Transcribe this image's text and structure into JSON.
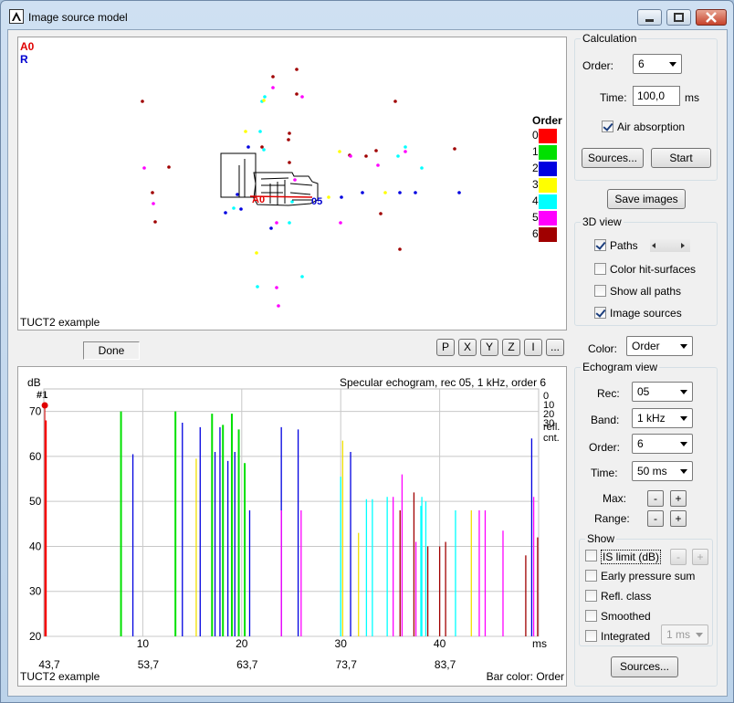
{
  "window": {
    "title": "Image source model"
  },
  "model_view": {
    "legend_a0": "A0",
    "legend_r": "R",
    "order_title": "Order",
    "order_legend": [
      {
        "label": "0",
        "color": "#ff0000"
      },
      {
        "label": "1",
        "color": "#00e000"
      },
      {
        "label": "2",
        "color": "#0000e0"
      },
      {
        "label": "3",
        "color": "#ffff00"
      },
      {
        "label": "4",
        "color": "#00ffff"
      },
      {
        "label": "5",
        "color": "#ff00ff"
      },
      {
        "label": "6",
        "color": "#a00000"
      }
    ],
    "source_label": "A0",
    "receiver_label": "05",
    "footer": "TUCT2 example"
  },
  "status": {
    "text": "Done"
  },
  "view_buttons": [
    "P",
    "X",
    "Y",
    "Z",
    "I",
    "..."
  ],
  "calculation": {
    "title": "Calculation",
    "order_label": "Order:",
    "order_value": "6",
    "time_label": "Time:",
    "time_value": "100,0",
    "time_unit": "ms",
    "air_absorption": "Air absorption",
    "sources_btn": "Sources...",
    "start_btn": "Start"
  },
  "save_images": "Save images",
  "view3d": {
    "title": "3D view",
    "paths": "Paths",
    "color_hit": "Color hit-surfaces",
    "show_all": "Show all paths",
    "image_sources": "Image sources"
  },
  "color": {
    "label": "Color:",
    "value": "Order"
  },
  "echogram_view": {
    "title": "Echogram view",
    "rec_label": "Rec:",
    "rec_value": "05",
    "band_label": "Band:",
    "band_value": "1 kHz",
    "order_label": "Order:",
    "order_value": "6",
    "time_label": "Time:",
    "time_value": "50 ms",
    "max_label": "Max:",
    "range_label": "Range:",
    "show_title": "Show",
    "is_limit": "IS limit (dB)",
    "early": "Early pressure sum",
    "refl_class": "Refl. class",
    "smoothed": "Smoothed",
    "integrated": "Integrated",
    "integrated_value": "1 ms",
    "sources_btn": "Sources..."
  },
  "chart_data": {
    "type": "bar",
    "title": "Specular echogram, rec 05, 1 kHz, order 6",
    "ylabel": "dB",
    "xlabel": "ms",
    "marker": "#1",
    "ylim": [
      20,
      75
    ],
    "y_ticks": [
      20,
      30,
      40,
      50,
      60,
      70
    ],
    "x_ticks": [
      "10",
      "20",
      "30",
      "40"
    ],
    "x_ticks_abs": [
      "43,7",
      "53,7",
      "63,7",
      "73,7",
      "83,7"
    ],
    "xlim": [
      0,
      50
    ],
    "refl_cnt_ticks": [
      "0",
      "10",
      "20",
      "30"
    ],
    "refl_cnt_label": "refl.\ncnt.",
    "footer_left": "TUCT2 example",
    "footer_right": "Bar color: Order",
    "bars": [
      {
        "x": 0.2,
        "y": 68,
        "order": 0
      },
      {
        "x": 7.8,
        "y": 70,
        "order": 1
      },
      {
        "x": 13.3,
        "y": 70,
        "order": 1
      },
      {
        "x": 17.0,
        "y": 69.5,
        "order": 1
      },
      {
        "x": 18.1,
        "y": 67,
        "order": 1
      },
      {
        "x": 19.0,
        "y": 69.5,
        "order": 1
      },
      {
        "x": 19.7,
        "y": 66,
        "order": 1
      },
      {
        "x": 20.3,
        "y": 58.5,
        "order": 1
      },
      {
        "x": 9.0,
        "y": 60.5,
        "order": 2
      },
      {
        "x": 14.0,
        "y": 67.5,
        "order": 2
      },
      {
        "x": 15.8,
        "y": 66.5,
        "order": 2
      },
      {
        "x": 17.3,
        "y": 61,
        "order": 2
      },
      {
        "x": 17.8,
        "y": 66.5,
        "order": 2
      },
      {
        "x": 18.6,
        "y": 59,
        "order": 2
      },
      {
        "x": 19.3,
        "y": 61,
        "order": 2
      },
      {
        "x": 20.8,
        "y": 48,
        "order": 2
      },
      {
        "x": 24.0,
        "y": 66.5,
        "order": 2
      },
      {
        "x": 25.7,
        "y": 66,
        "order": 2
      },
      {
        "x": 31.0,
        "y": 61,
        "order": 2
      },
      {
        "x": 49.3,
        "y": 64,
        "order": 2
      },
      {
        "x": 15.4,
        "y": 59.5,
        "order": 3
      },
      {
        "x": 30.2,
        "y": 63.5,
        "order": 3
      },
      {
        "x": 31.8,
        "y": 43,
        "order": 3
      },
      {
        "x": 43.2,
        "y": 48,
        "order": 3
      },
      {
        "x": 30.0,
        "y": 55.5,
        "order": 4
      },
      {
        "x": 32.6,
        "y": 50.5,
        "order": 4
      },
      {
        "x": 33.2,
        "y": 50.5,
        "order": 4
      },
      {
        "x": 34.7,
        "y": 51,
        "order": 4
      },
      {
        "x": 38.2,
        "y": 51,
        "order": 4
      },
      {
        "x": 38.6,
        "y": 50,
        "order": 4
      },
      {
        "x": 41.6,
        "y": 48,
        "order": 4
      },
      {
        "x": 38.1,
        "y": 49,
        "order": 4
      },
      {
        "x": 24.0,
        "y": 48,
        "order": 5
      },
      {
        "x": 26.0,
        "y": 48,
        "order": 5
      },
      {
        "x": 35.3,
        "y": 51,
        "order": 5
      },
      {
        "x": 36.2,
        "y": 56,
        "order": 5
      },
      {
        "x": 37.6,
        "y": 41,
        "order": 5
      },
      {
        "x": 44.0,
        "y": 48,
        "order": 5
      },
      {
        "x": 44.6,
        "y": 48,
        "order": 5
      },
      {
        "x": 46.4,
        "y": 43.5,
        "order": 5
      },
      {
        "x": 49.5,
        "y": 51,
        "order": 5
      },
      {
        "x": 36.0,
        "y": 48,
        "order": 6
      },
      {
        "x": 37.4,
        "y": 52,
        "order": 6
      },
      {
        "x": 38.8,
        "y": 40,
        "order": 6
      },
      {
        "x": 40.0,
        "y": 40,
        "order": 6
      },
      {
        "x": 40.6,
        "y": 41,
        "order": 6
      },
      {
        "x": 48.7,
        "y": 38,
        "order": 6
      },
      {
        "x": 49.9,
        "y": 42,
        "order": 6
      }
    ]
  }
}
